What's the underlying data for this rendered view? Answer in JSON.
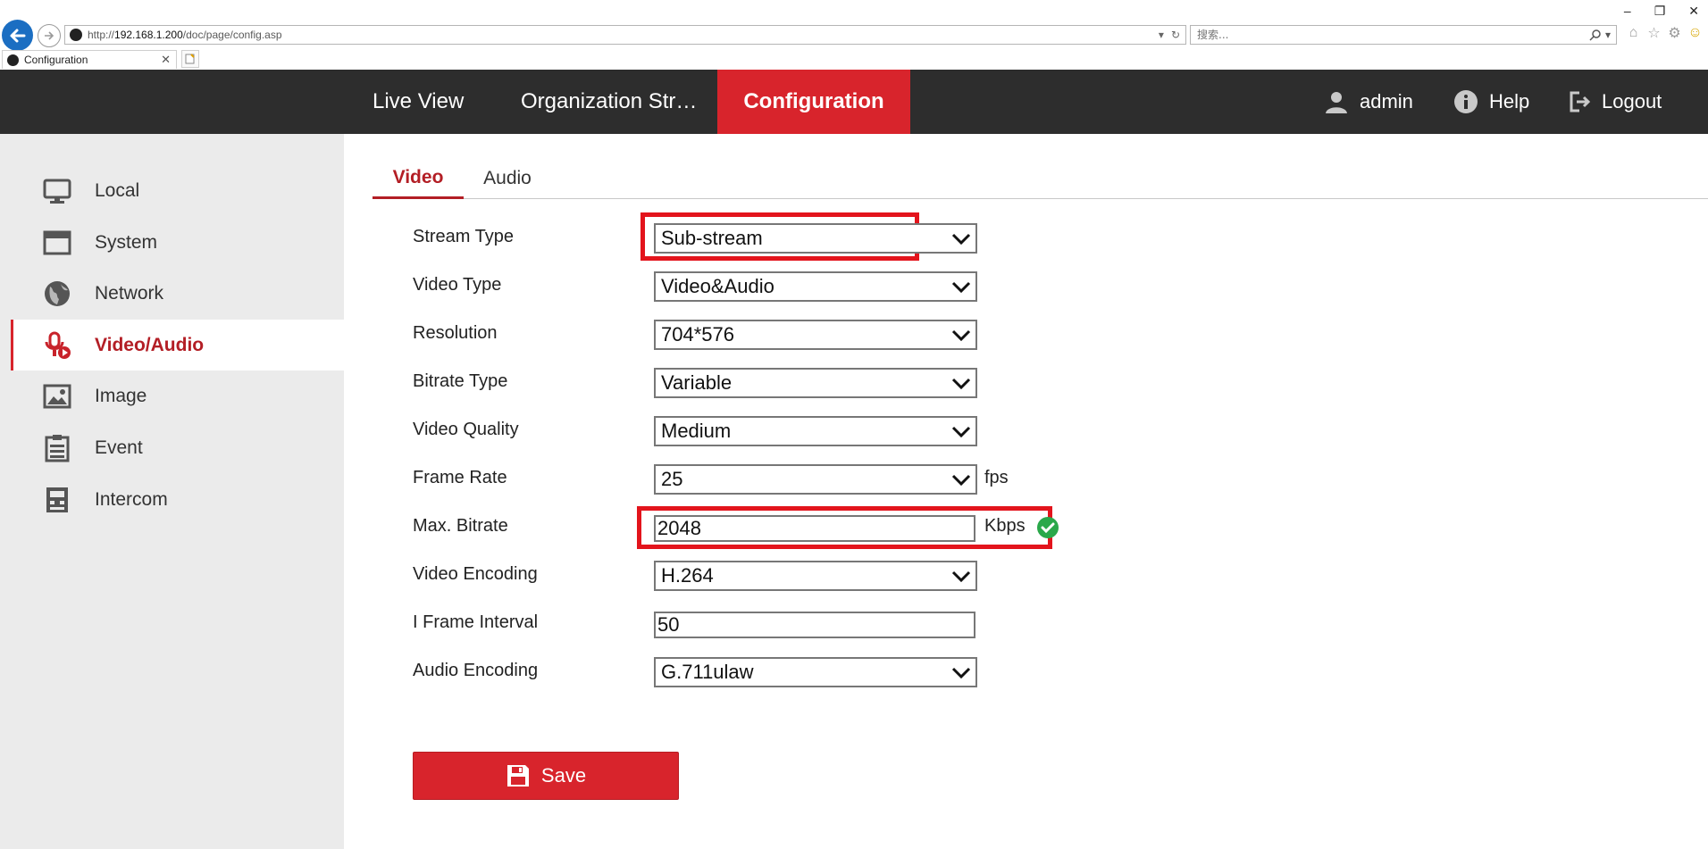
{
  "browser": {
    "url_prefix": "http://",
    "url_host": "192.168.1.200",
    "url_path": "/doc/page/config.asp",
    "search_placeholder": "搜索...",
    "tab_title": "Configuration"
  },
  "header": {
    "nav": [
      {
        "label": "Live View"
      },
      {
        "label": "Organization Str…"
      },
      {
        "label": "Configuration"
      }
    ],
    "user": "admin",
    "help": "Help",
    "logout": "Logout"
  },
  "sidebar": {
    "items": [
      {
        "label": "Local",
        "icon": "monitor-icon"
      },
      {
        "label": "System",
        "icon": "window-icon"
      },
      {
        "label": "Network",
        "icon": "globe-icon"
      },
      {
        "label": "Video/Audio",
        "icon": "microphone-video-icon",
        "active": true
      },
      {
        "label": "Image",
        "icon": "image-icon"
      },
      {
        "label": "Event",
        "icon": "clipboard-list-icon"
      },
      {
        "label": "Intercom",
        "icon": "intercom-icon"
      }
    ]
  },
  "main": {
    "tabs": [
      {
        "label": "Video",
        "active": true
      },
      {
        "label": "Audio"
      }
    ],
    "form": {
      "stream_type": {
        "label": "Stream Type",
        "value": "Sub-stream"
      },
      "video_type": {
        "label": "Video Type",
        "value": "Video&Audio"
      },
      "resolution": {
        "label": "Resolution",
        "value": "704*576"
      },
      "bitrate_type": {
        "label": "Bitrate Type",
        "value": "Variable"
      },
      "video_quality": {
        "label": "Video Quality",
        "value": "Medium"
      },
      "frame_rate": {
        "label": "Frame Rate",
        "value": "25",
        "unit": "fps"
      },
      "max_bitrate": {
        "label": "Max. Bitrate",
        "value": "2048",
        "unit": "Kbps"
      },
      "video_encoding": {
        "label": "Video Encoding",
        "value": "H.264"
      },
      "i_frame_interval": {
        "label": "I Frame Interval",
        "value": "50"
      },
      "audio_encoding": {
        "label": "Audio Encoding",
        "value": "G.711ulaw"
      }
    },
    "save_label": "Save"
  },
  "colors": {
    "accent": "#d8242c",
    "header_bg": "#2d2d2d",
    "sidebar_bg": "#ebebeb",
    "highlight": "#e3141c",
    "success": "#2aa84a"
  }
}
